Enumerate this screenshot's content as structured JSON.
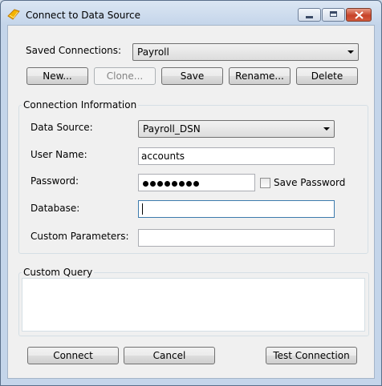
{
  "window": {
    "title": "Connect to Data Source"
  },
  "saved": {
    "label": "Saved Connections:",
    "selected": "Payroll",
    "buttons": {
      "new": "New...",
      "clone": "Clone...",
      "save": "Save",
      "rename": "Rename...",
      "delete": "Delete"
    }
  },
  "connection": {
    "group_title": "Connection Information",
    "data_source_label": "Data Source:",
    "data_source_value": "Payroll_DSN",
    "username_label": "User Name:",
    "username_value": "accounts",
    "password_label": "Password:",
    "password_length": 8,
    "save_password_label": "Save Password",
    "save_password_checked": false,
    "database_label": "Database:",
    "database_value": "",
    "custom_params_label": "Custom Parameters:",
    "custom_params_value": ""
  },
  "query": {
    "group_title": "Custom Query",
    "value": ""
  },
  "footer": {
    "connect": "Connect",
    "cancel": "Cancel",
    "test": "Test Connection"
  }
}
